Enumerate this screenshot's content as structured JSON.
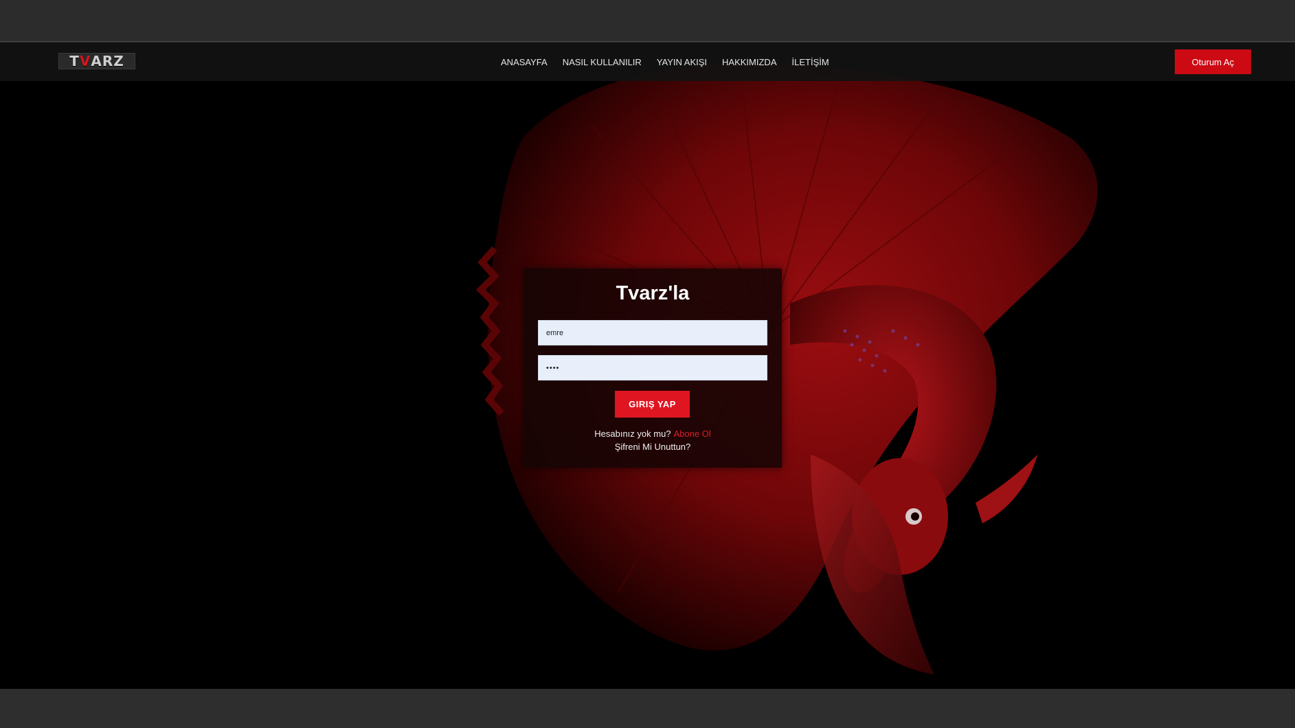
{
  "header": {
    "logo_text_a": "T",
    "logo_text_v": "V",
    "logo_text_b": "ARZ",
    "nav": [
      {
        "label": "ANASAYFA"
      },
      {
        "label": "NASIL KULLANILIR"
      },
      {
        "label": "YAYIN AKIŞI"
      },
      {
        "label": "HAKKIMIZDA"
      },
      {
        "label": "İLETİŞİM"
      }
    ],
    "login_label": "Oturum Aç"
  },
  "login": {
    "title": "Tvarz'la",
    "username_value": "emre",
    "password_value": "1234",
    "submit_label": "GIRIŞ YAP",
    "no_account_text": "Hesabınız yok mu?",
    "signup_link": "Abone Ol",
    "forgot_link": "Şifreni Mi Unuttun?"
  },
  "colors": {
    "accent": "#cc0a14",
    "background": "#000000",
    "frame": "#2c2c2c"
  }
}
